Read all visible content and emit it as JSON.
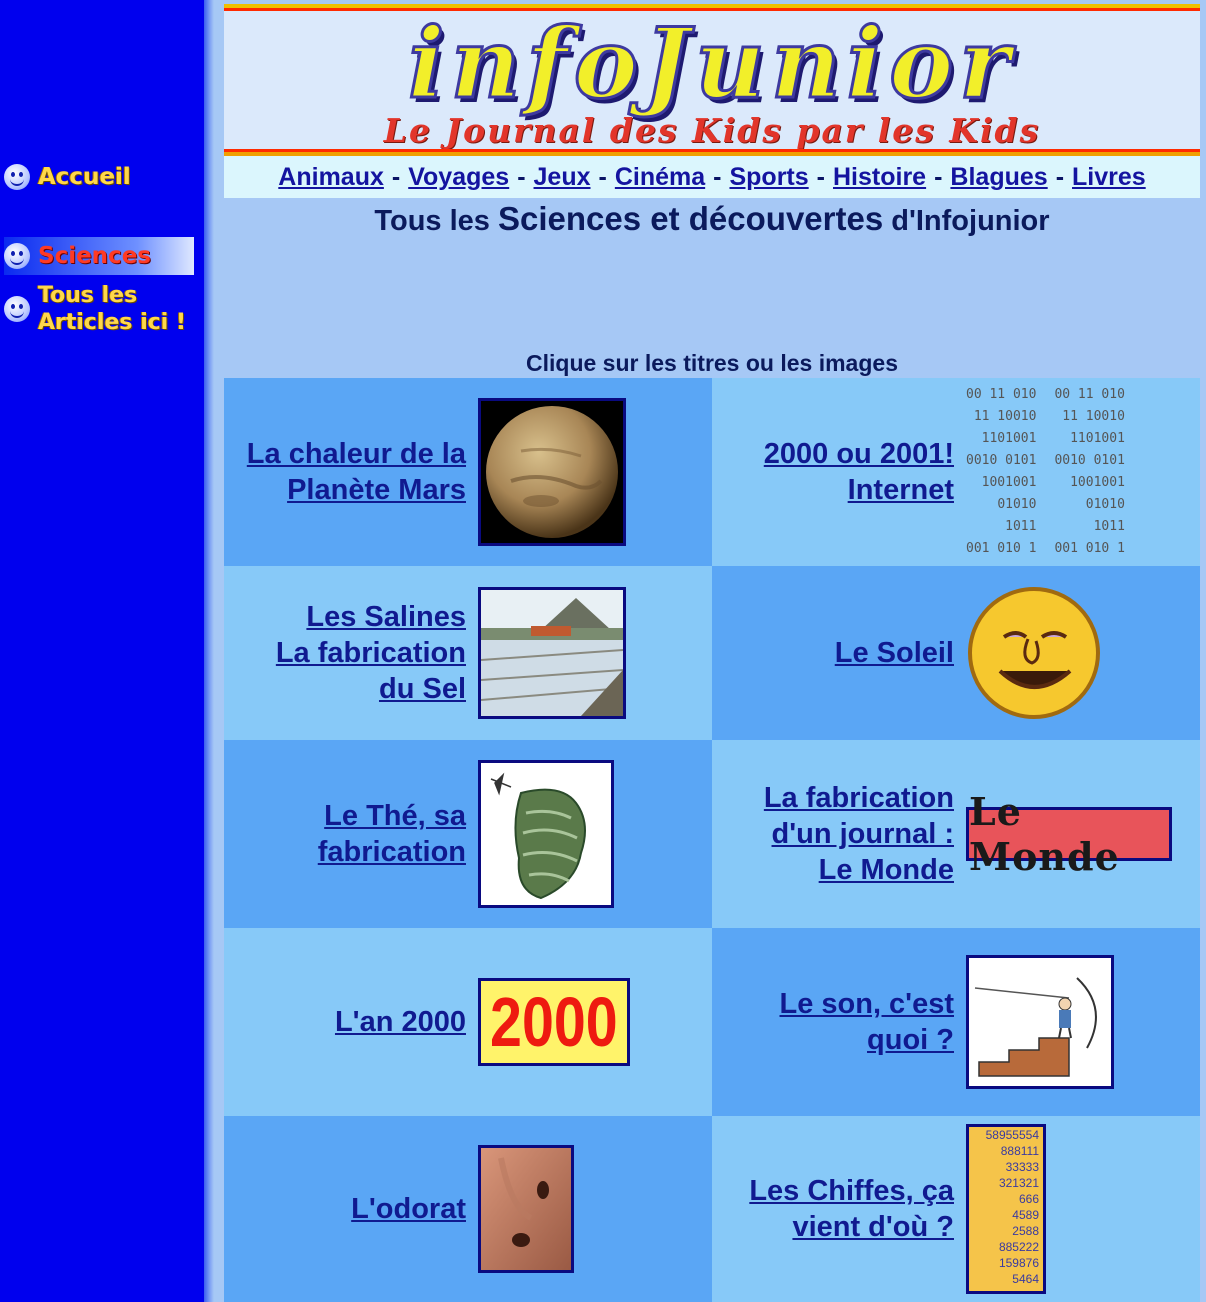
{
  "sidebar": {
    "items": [
      {
        "label": "Accueil"
      },
      {
        "label": "Sciences"
      },
      {
        "label": "Tous les Articles ici !",
        "line1": "Tous les",
        "line2": "Articles ici !"
      }
    ]
  },
  "banner": {
    "logo": "infoJunior",
    "tagline": "Le Journal des Kids par les Kids"
  },
  "nav": {
    "links": [
      "Animaux",
      "Voyages",
      "Jeux",
      "Cinéma",
      "Sports",
      "Histoire",
      "Blagues",
      "Livres"
    ],
    "separator": "-"
  },
  "title": {
    "prefix": "Tous les",
    "main": "Sciences et découvertes",
    "suffix": "d'Infojunior"
  },
  "hint": "Clique sur les titres ou les images",
  "articles": [
    {
      "title_l1": "La chaleur de la",
      "title_l2": "Planète Mars",
      "image": "mars-planet"
    },
    {
      "title_l1": "2000 ou 2001!",
      "title_l2": "Internet",
      "image": "binary-digits"
    },
    {
      "title_l1": "Les Salines",
      "title_l2": "La fabrication",
      "title_l3": "du Sel",
      "image": "salt-pans-photo"
    },
    {
      "title_l1": "Le Soleil",
      "image": "sun-face"
    },
    {
      "title_l1": "Le Thé, sa",
      "title_l2": "fabrication",
      "image": "tea-plantation-map"
    },
    {
      "title_l1": "La fabrication",
      "title_l2": "d'un journal :",
      "title_l3": "Le Monde",
      "image": "le-monde-logo",
      "logo_text": "Le Monde"
    },
    {
      "title_l1": "L'an 2000",
      "image": "year-2000",
      "logo_text": "2000"
    },
    {
      "title_l1": "Le son, c'est",
      "title_l2": "quoi ?",
      "image": "sound-drawing"
    },
    {
      "title_l1": "L'odorat",
      "image": "nose-photo"
    },
    {
      "title_l1": "Les Chiffes, ça",
      "title_l2": "vient d'où ?",
      "image": "numbers-column",
      "numbers": [
        "58955554",
        "888111",
        "33333",
        "321321",
        "666",
        "4589",
        "2588",
        "885222",
        "159876",
        "5464"
      ]
    }
  ],
  "binary_text": [
    "00 11 010",
    "11 10010",
    "1101001",
    "0010 0101",
    "1001001",
    "01010",
    "1011",
    "001 010 1"
  ],
  "colors": {
    "sidebar": "#0000ee",
    "cell_dark": "#5aa6f5",
    "cell_light": "#87c9f8",
    "link": "#101a90",
    "page_bg": "#a6c8f5"
  }
}
